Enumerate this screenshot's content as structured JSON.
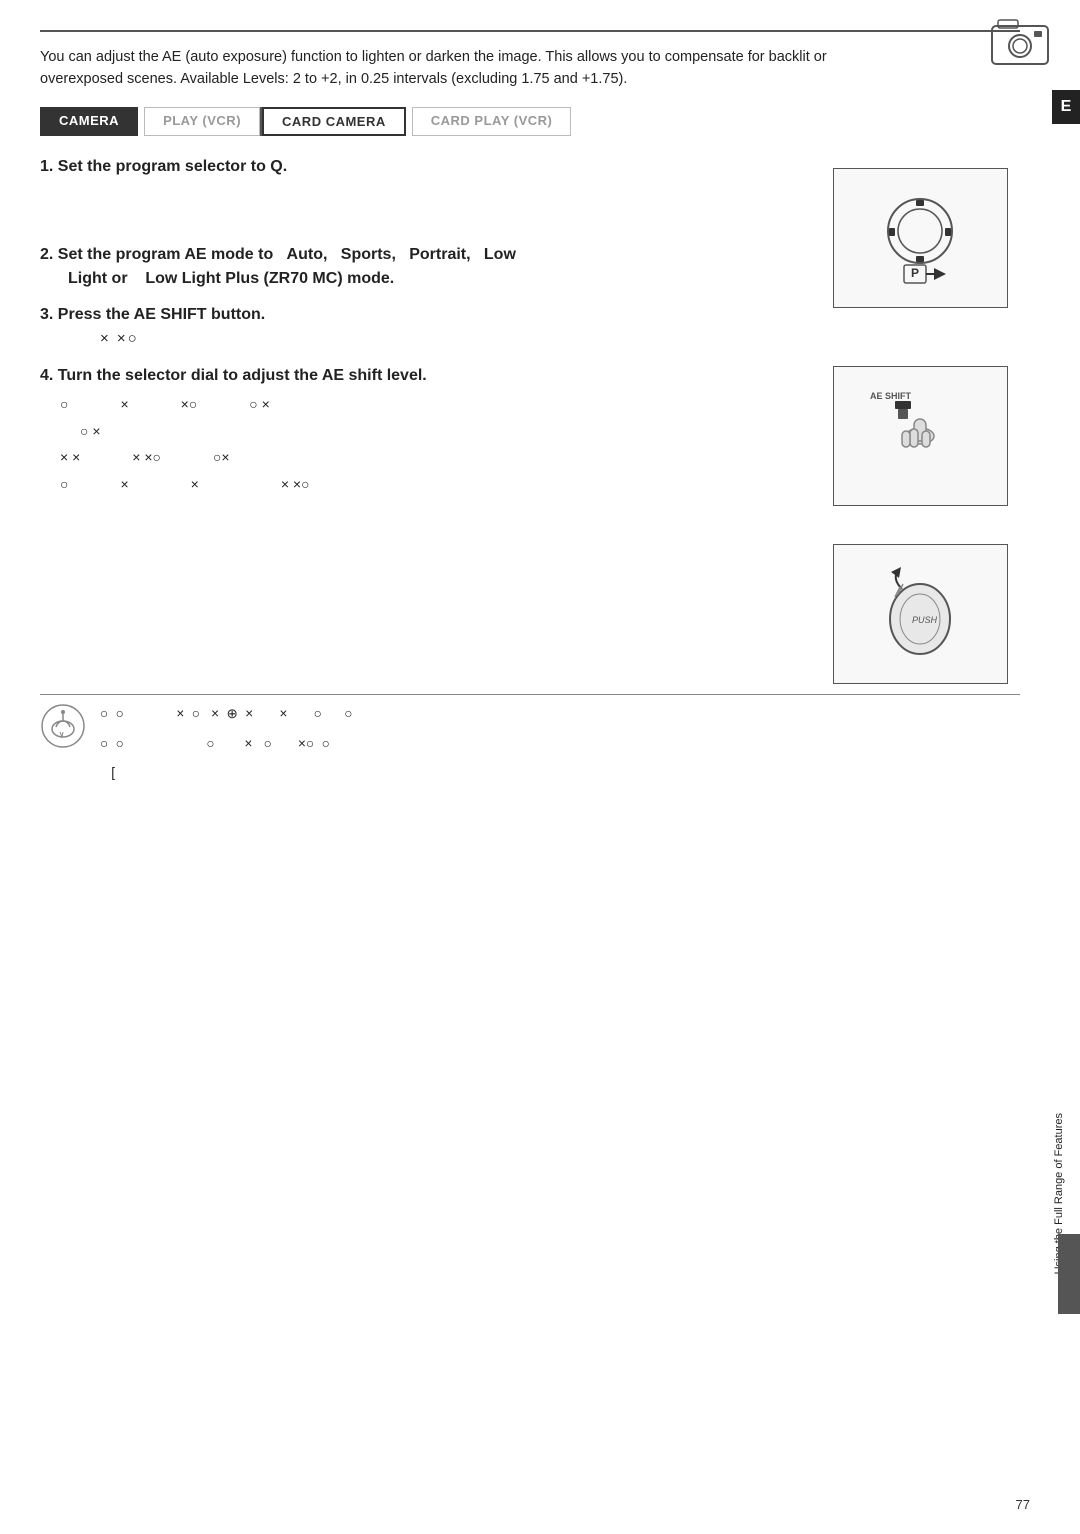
{
  "page": {
    "number": "77",
    "top_icon_alt": "camera-icon"
  },
  "sidebar": {
    "letter": "E",
    "label": "Using the Full Range of Features"
  },
  "intro": {
    "text": "You can adjust the AE (auto exposure) function to lighten or darken the image. This allows you to compensate for backlit or overexposed scenes. Available Levels:  2 to +2, in 0.25 intervals (excluding  1.75 and +1.75)."
  },
  "tabs": [
    {
      "label": "CAMERA",
      "state": "active"
    },
    {
      "label": "PLAY (VCR)",
      "state": "inactive"
    },
    {
      "label": "CARD CAMERA",
      "state": "active-outline"
    },
    {
      "label": "CARD PLAY (VCR)",
      "state": "inactive"
    }
  ],
  "steps": [
    {
      "number": "1",
      "text": "Set the program selector to Q."
    },
    {
      "number": "2",
      "text": "Set the program AE mode to  Auto,  Sports,  Portrait,  Low Light or  Low Light Plus (ZR70 MC) mode."
    },
    {
      "number": "3",
      "text": "Press the AE SHIFT button.",
      "symbol": "× ×○"
    },
    {
      "number": "4",
      "text": "Turn the selector dial to adjust the AE shift level.",
      "rows": [
        [
          "○",
          "×",
          "×○",
          "○ ×"
        ],
        [
          "○ ×"
        ],
        [
          "× ×",
          "× ×○",
          "○×"
        ],
        [
          "○",
          "×",
          "×",
          "× ×○"
        ]
      ]
    }
  ],
  "note": {
    "text": "○  ○            ×  ○   ×  ⊕  ×       ×      ○     ○\n\n○  ○                    ○       ×   ○       ×○  ○\n\n["
  },
  "diagrams": {
    "step1_alt": "program-selector-dial",
    "step3_alt": "ae-shift-button",
    "step4_alt": "selector-dial"
  }
}
